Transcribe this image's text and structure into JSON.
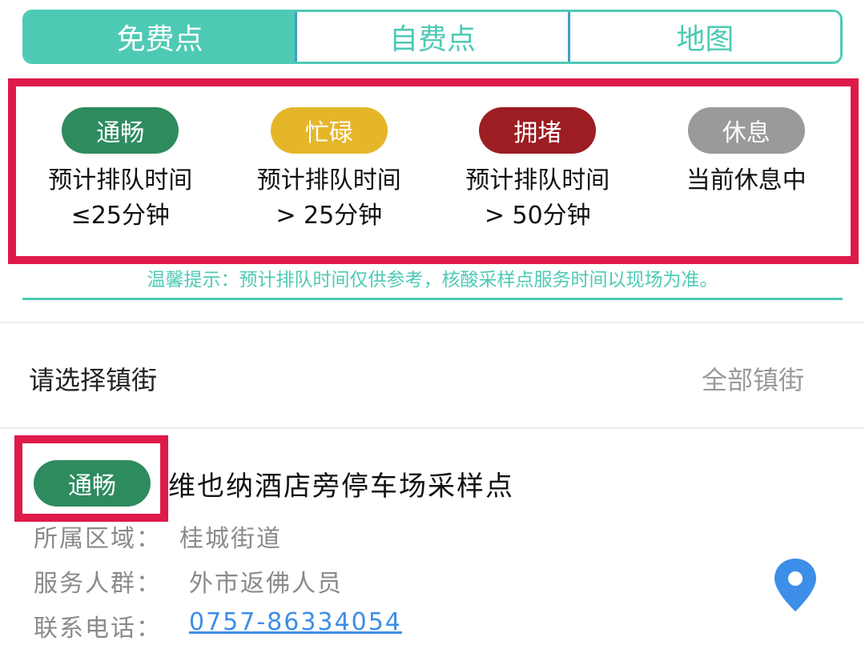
{
  "tabs": [
    {
      "label": "免费点",
      "active": true
    },
    {
      "label": "自费点",
      "active": false
    },
    {
      "label": "地图",
      "active": false
    }
  ],
  "legend": [
    {
      "status": "通畅",
      "color": "#2e8b5e",
      "line1": "预计排队时间",
      "line2": "≤25分钟"
    },
    {
      "status": "忙碌",
      "color": "#e5b62a",
      "line1": "预计排队时间",
      "line2": "> 25分钟"
    },
    {
      "status": "拥堵",
      "color": "#9c1d22",
      "line1": "预计排队时间",
      "line2": "> 50分钟"
    },
    {
      "status": "休息",
      "color": "#9a9a9a",
      "line1": "当前休息中",
      "line2": ""
    }
  ],
  "tip": "温馨提示：预计排队时间仅供参考，核酸采样点服务时间以现场为准。",
  "town_filter": {
    "label": "请选择镇街",
    "value": "全部镇街"
  },
  "site": {
    "status": "通畅",
    "name": "维也纳酒店旁停车场采样点",
    "area_label": "所属区域：",
    "area": "桂城街道",
    "group_label": "服务人群：",
    "group": "外市返佛人员",
    "phone_label": "联系电话：",
    "phone": "0757-86334054"
  },
  "colors": {
    "accent": "#4ecab4",
    "highlight": "#de1a4a",
    "link": "#3d8ee8",
    "pin": "#3d8ee8"
  },
  "icons": {
    "location": "location-pin-icon"
  }
}
